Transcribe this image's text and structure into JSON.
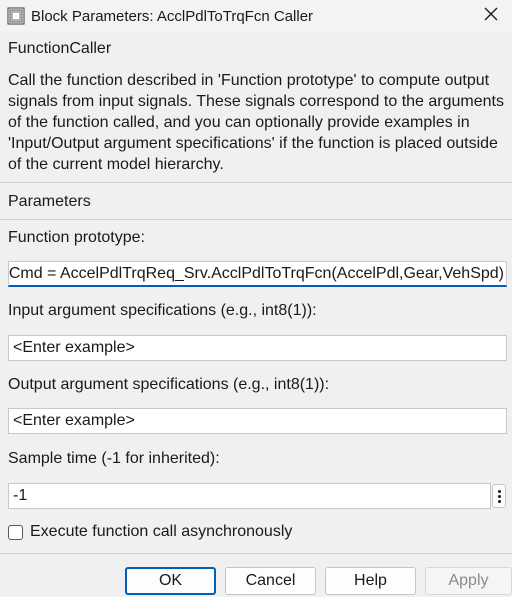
{
  "window": {
    "title": "Block Parameters: AcclPdlToTrqFcn Caller",
    "icons": {
      "app": "simulink-block-icon",
      "close": "close-icon"
    }
  },
  "block_type": "FunctionCaller",
  "description": "Call the function described in 'Function prototype' to compute output signals from input signals. These signals correspond to the arguments of the function called, and you can optionally provide examples in 'Input/Output argument specifications' if the function is placed outside of the current model hierarchy.",
  "parameters": {
    "heading": "Parameters",
    "function_prototype": {
      "label": "Function prototype:",
      "value": "Cmd = AccelPdlTrqReq_Srv.AcclPdlToTrqFcn(AccelPdl,Gear,VehSpd)"
    },
    "input_spec": {
      "label": "Input argument specifications (e.g., int8(1)):",
      "value": "<Enter example>"
    },
    "output_spec": {
      "label": "Output argument specifications (e.g., int8(1)):",
      "value": "<Enter example>"
    },
    "sample_time": {
      "label": "Sample time (-1 for inherited):",
      "value": "-1"
    },
    "async": {
      "label": "Execute function call asynchronously",
      "checked": false
    }
  },
  "buttons": {
    "ok": "OK",
    "cancel": "Cancel",
    "help": "Help",
    "apply": "Apply"
  },
  "colors": {
    "accent": "#005fb8",
    "background": "#f0f0f0",
    "text": "#1a1a1a",
    "disabled_text": "#8a8a8a"
  }
}
